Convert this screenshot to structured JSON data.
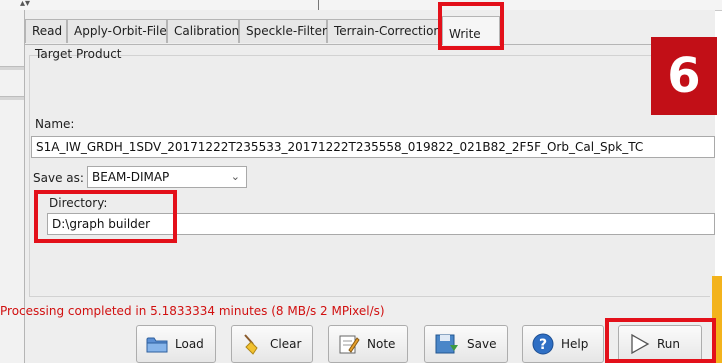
{
  "tabs": [
    {
      "label": "Read"
    },
    {
      "label": "Apply-Orbit-File"
    },
    {
      "label": "Calibration"
    },
    {
      "label": "Speckle-Filter"
    },
    {
      "label": "Terrain-Correction"
    },
    {
      "label": "Write",
      "active": true
    }
  ],
  "section_title": "Target Product",
  "name_label": "Name:",
  "name_value": "S1A_IW_GRDH_1SDV_20171222T235533_20171222T235558_019822_021B82_2F5F_Orb_Cal_Spk_TC",
  "save_as_label": "Save as:",
  "save_as_value": "BEAM-DIMAP",
  "directory_label": "Directory:",
  "directory_value": "D:\\graph builder",
  "step_badge": "6",
  "status": "Processing completed in 5.1833334 minutes (8 MB/s 2 MPixel/s)",
  "buttons": {
    "load": "Load",
    "clear": "Clear",
    "note": "Note",
    "save": "Save",
    "help": "Help",
    "run": "Run"
  },
  "colors": {
    "highlight": "#e3101a",
    "badge": "#c20f17",
    "status_text": "#d11010",
    "accent_orange": "#f3b31c"
  }
}
